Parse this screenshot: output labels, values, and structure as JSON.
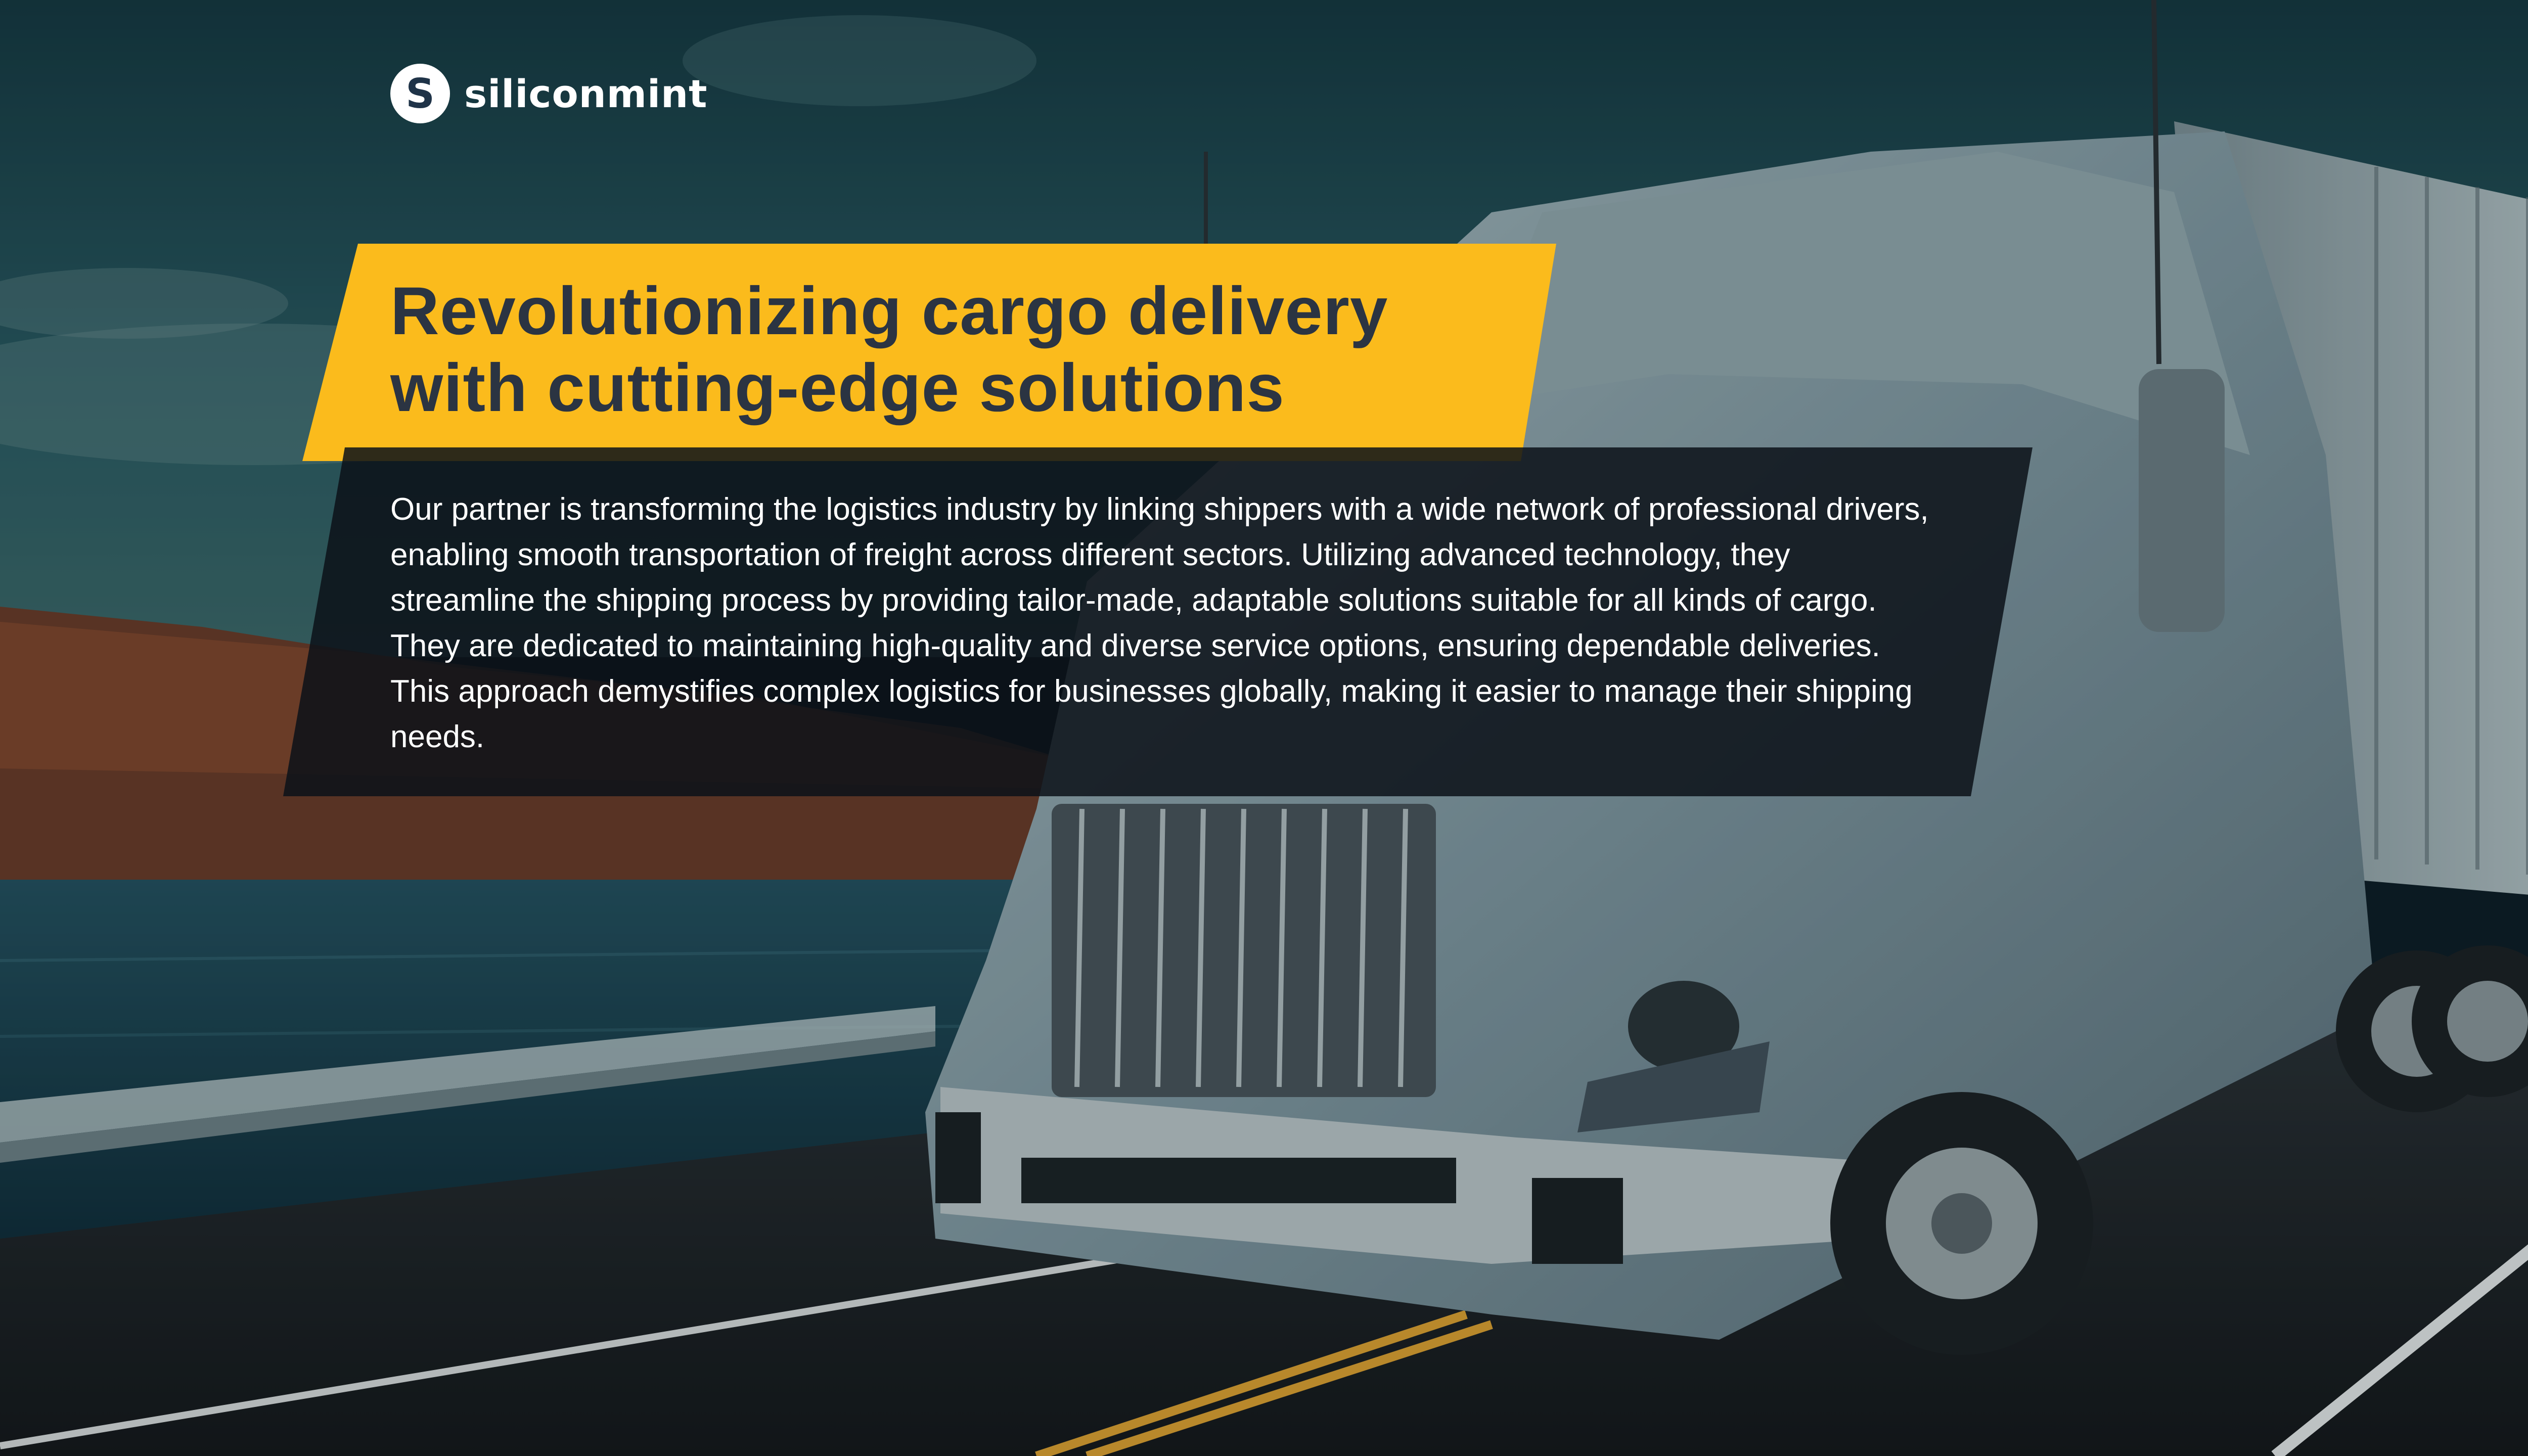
{
  "brand": {
    "logo_letter": "S",
    "name": "siliconmint"
  },
  "hero": {
    "headline": "Revolutionizing cargo delivery with cutting-edge solutions",
    "description": "Our partner is transforming the logistics industry by linking shippers with a wide network of professional drivers, enabling smooth transportation of freight across different sectors. Utilizing advanced technology, they streamline the shipping process by providing tailor-made, adaptable solutions suitable for all kinds of cargo. They are dedicated to maintaining high-quality and diverse service options, ensuring dependable deliveries. This approach demystifies complex logistics for businesses globally, making it easier to manage their shipping needs."
  },
  "colors": {
    "accent_yellow": "#fbbb1c",
    "headline_text": "#2b3442",
    "overlay_dark": "#0c1119",
    "sky": "#1f4a55",
    "water": "#163846",
    "road": "#1b1e22",
    "truck_body": "#8fa3a8"
  },
  "icons": {
    "logo": "siliconmint-logo-icon"
  }
}
